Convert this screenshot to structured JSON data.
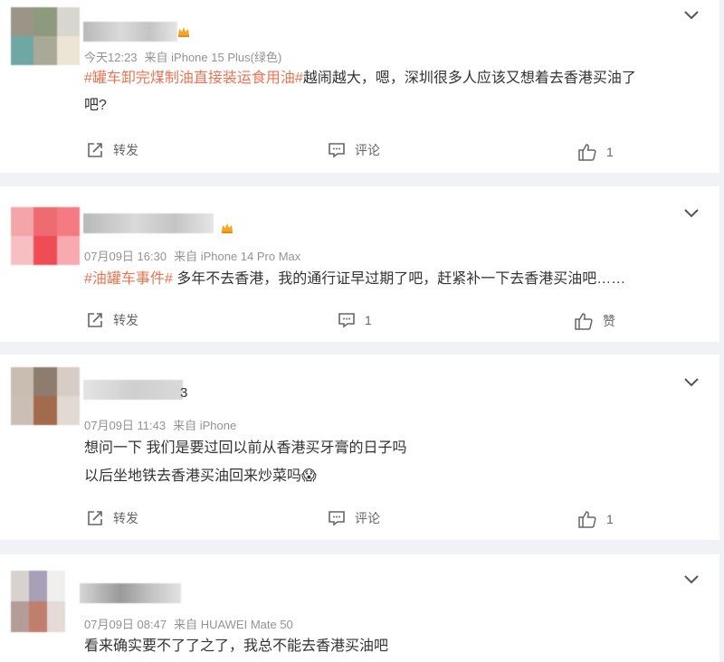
{
  "comments": [
    {
      "meta_time": "今天12:23",
      "meta_device": "来自 iPhone 15 Plus(绿色)",
      "tag": "#罐车卸完煤制油直接装运食用油#",
      "line1": "越闹越大，嗯，深圳很多人应该又想着去香港买油了",
      "line2": "吧?",
      "share_label": "转发",
      "comment_label": "评论",
      "like_label": "1"
    },
    {
      "meta_time": "07月09日 16:30",
      "meta_device": "来自 iPhone 14 Pro Max",
      "tag": "#油罐车事件#",
      "line1": " 多年不去香港，我的通行证早过期了吧，赶紧补一下去香港买油吧……",
      "share_label": "转发",
      "comment_label": "1",
      "like_label": "赞"
    },
    {
      "name_fragment": "3",
      "meta_time": "07月09日 11:43",
      "meta_device": "来自 iPhone",
      "line1": "想问一下 我们是要过回以前从香港买牙膏的日子吗",
      "line2": "以后坐地铁去香港买油回来炒菜吗",
      "emoji": "😱",
      "share_label": "转发",
      "comment_label": "评论",
      "like_label": "1"
    },
    {
      "meta_time": "07月09日 08:47",
      "meta_device": "来自 HUAWEI Mate 50",
      "line1": "看来确实要不了了之了，我总不能去香港买油吧"
    }
  ],
  "icons": {
    "chevron": "chevron-down-icon",
    "share": "share-icon",
    "comment": "comment-icon",
    "like": "like-icon",
    "crown": "crown-badge-icon"
  },
  "colors": {
    "background": "#f1f2f5",
    "card": "#ffffff",
    "hashtag": "#eb7350",
    "meta": "#939393",
    "text": "#333333"
  }
}
